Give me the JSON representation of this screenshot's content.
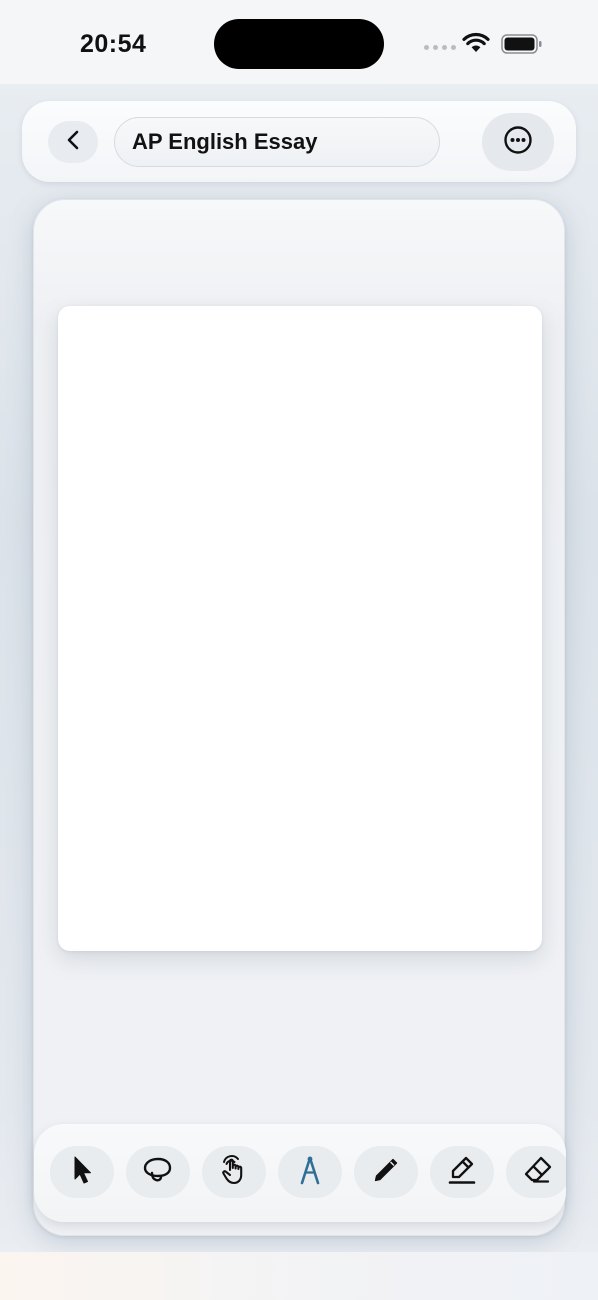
{
  "status_bar": {
    "time": "20:54",
    "signal_icon": "signal-dots-icon",
    "wifi_icon": "wifi-icon",
    "battery_icon": "battery-icon"
  },
  "top_bar": {
    "back_icon": "chevron-left-icon",
    "document_title": "AP English Essay",
    "more_icon": "ellipsis-circle-icon"
  },
  "tools": [
    {
      "name": "select",
      "icon": "arrow-pointer-icon"
    },
    {
      "name": "lasso",
      "icon": "lasso-icon"
    },
    {
      "name": "touch",
      "icon": "hand-touch-icon"
    },
    {
      "name": "ruler",
      "icon": "compass-icon",
      "selected": true
    },
    {
      "name": "pen",
      "icon": "pencil-icon"
    },
    {
      "name": "highlighter",
      "icon": "highlighter-icon"
    },
    {
      "name": "eraser",
      "icon": "eraser-icon"
    }
  ],
  "colors": {
    "accent": "#2f6f96",
    "icon": "#1a1a1a"
  }
}
